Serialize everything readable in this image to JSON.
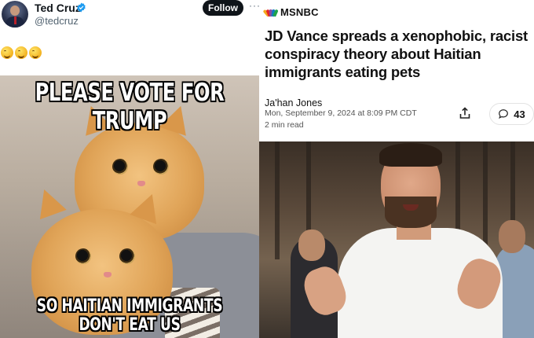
{
  "tweet": {
    "author_name": "Ted Cruz",
    "handle": "@tedcruz",
    "follow_label": "Follow",
    "more_label": "···",
    "reaction_emojis": [
      "rolling-on-floor-laughing",
      "rolling-on-floor-laughing",
      "rolling-on-floor-laughing"
    ],
    "meme": {
      "top_text": "PLEASE VOTE FOR TRUMP",
      "bottom_text": "SO HAITIAN IMMIGRANTS DON'T EAT US"
    }
  },
  "article": {
    "outlet": "MSNBC",
    "headline": "JD Vance spreads a xenophobic, racist conspiracy theory about Haitian immigrants eating pets",
    "author": "Ja'han Jones",
    "dateline": "Mon, September 9, 2024 at 8:09 PM CDT",
    "read_time": "2 min read",
    "comment_count": "43"
  },
  "colors": {
    "follow_bg": "#0f1419",
    "verified_blue": "#1d9bf0",
    "peacock": [
      "#f6a81c",
      "#e1242a",
      "#8a4c9c",
      "#1478c1",
      "#1ea34a",
      "#f37021"
    ]
  }
}
